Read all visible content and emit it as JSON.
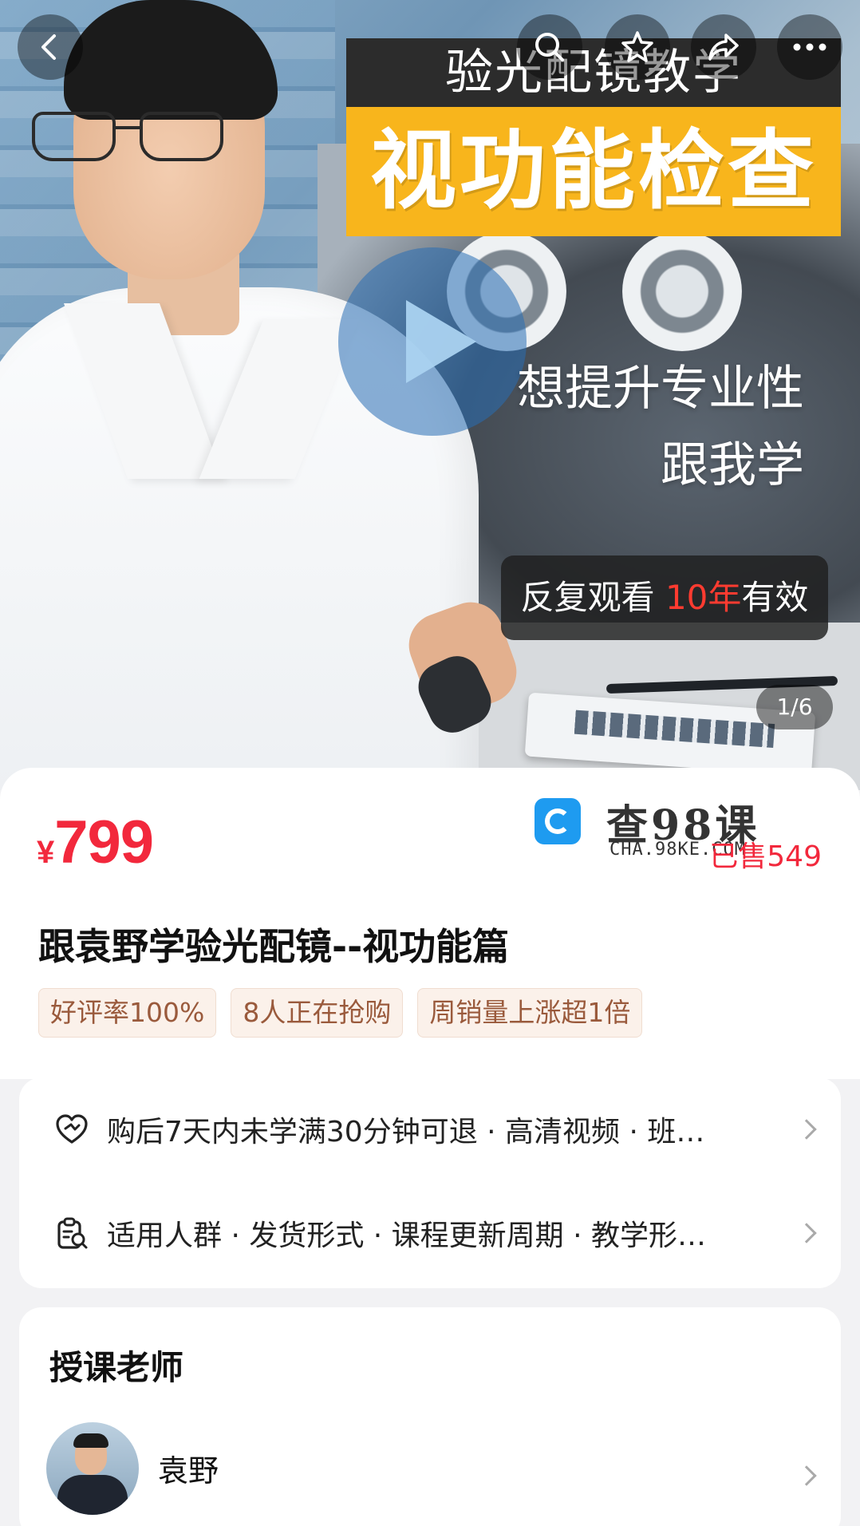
{
  "hero": {
    "title_top": "验光配镜教学",
    "title_main": "视功能检查",
    "slogan_line1": "想提升专业性",
    "slogan_line2": "跟我学",
    "replay_prefix": "反复观看 ",
    "replay_highlight": "10年",
    "replay_suffix": "有效",
    "pager": "1/6"
  },
  "nav": {
    "icons": [
      "back-icon",
      "search-icon",
      "favorite-icon",
      "share-icon",
      "more-icon"
    ]
  },
  "product": {
    "currency": "¥",
    "price": "799",
    "sold": "已售549",
    "title": "跟袁野学验光配镜--视功能篇",
    "tags": [
      "好评率100%",
      "8人正在抢购",
      "周销量上涨超1倍"
    ]
  },
  "watermark": {
    "name": "查98课",
    "url": "CHA.98KE.COM"
  },
  "info_rows": [
    {
      "icon": "heart-shield-icon",
      "text": "购后7天内未学满30分钟可退 · 高清视频 · 班…"
    },
    {
      "icon": "clipboard-search-icon",
      "text": "适用人群 · 发货形式 · 课程更新周期 · 教学形…"
    }
  ],
  "teacher": {
    "heading": "授课老师",
    "name": "袁野"
  },
  "colors": {
    "price_red": "#f2283c",
    "banner_yellow": "#f8b51c",
    "tag_text": "#9a5a3c"
  }
}
